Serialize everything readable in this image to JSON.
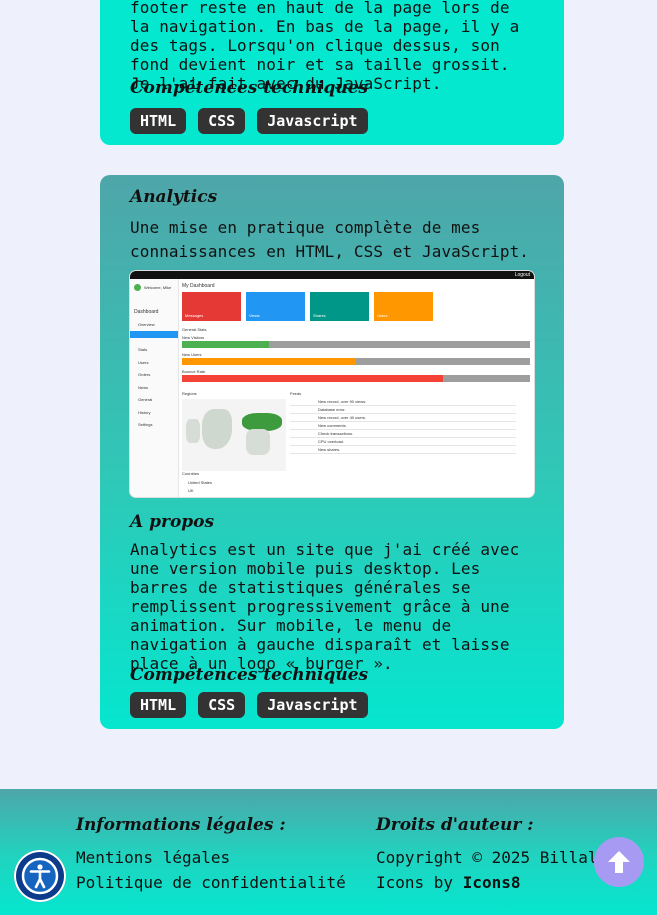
{
  "top_project": {
    "paragraph": "footer reste en haut de la page lors de la navigation. En bas de la page, il y a des tags. Lorsqu'on clique dessus, son fond devient noir et sa taille grossit. Je l'ai fait avec du JavaScript.",
    "skills_heading": "Compétences techniques",
    "tags": [
      "HTML",
      "CSS",
      "Javascript"
    ]
  },
  "analytics": {
    "title": "Analytics",
    "intro": "Une mise en pratique complète de mes connaissances en HTML, CSS et JavaScript.",
    "screenshot": {
      "logout": "Logout",
      "welcome": "Welcome, Mike",
      "page_title": "My Dashboard",
      "nav": [
        "Dashboard",
        "Overview",
        "Stats",
        "Users",
        "Orders",
        "News",
        "General",
        "History",
        "Settings"
      ],
      "tiles": [
        {
          "label": "Messages",
          "color": "#e53935"
        },
        {
          "label": "Views",
          "color": "#2196f3"
        },
        {
          "label": "Shares",
          "color": "#009688"
        },
        {
          "label": "Users",
          "color": "#ff9800"
        }
      ],
      "general_stats": "General Stats",
      "bars": [
        {
          "label": "New Visitors",
          "fill": 0.25,
          "color": "#4caf50"
        },
        {
          "label": "New Users",
          "fill": 0.5,
          "color": "#ff9800"
        },
        {
          "label": "Bounce Rate",
          "fill": 0.75,
          "color": "#f44336"
        }
      ],
      "regions": "Regions",
      "feeds": "Feeds",
      "feed_items": [
        "New record, over 90 views.",
        "Database error.",
        "New record, over 40 users.",
        "New comments.",
        "Check transactions.",
        "CPU overload.",
        "New shares."
      ],
      "countries": "Countries",
      "country_rows": [
        "United States",
        "UK"
      ]
    },
    "about_heading": "A propos",
    "about": "Analytics est un site que j'ai créé avec une version mobile puis desktop. Les barres de statistiques générales se remplissent progressivement grâce à une animation. Sur mobile, le menu de navigation à gauche disparaît et laisse place à un logo « burger ».",
    "skills_heading": "Compétences techniques",
    "tags": [
      "HTML",
      "CSS",
      "Javascript"
    ]
  },
  "footer": {
    "legal_title": "Informations légales :",
    "legal_links": [
      "Mentions légales",
      "Politique de confidentialité"
    ],
    "copyright_title": "Droits d'auteur :",
    "copyright_text": "Copyright © 2025 BillalDev",
    "icons_prefix": "Icons by ",
    "icons_link": "Icons8"
  },
  "icons": {
    "accessibility": "accessibility-icon",
    "scroll_top": "arrow-up-icon"
  },
  "colors": {
    "card_accent": "#04e8cf",
    "tag_bg": "#333333",
    "scroll_top_bg": "#a79af2",
    "a11y_bg": "#0d3b8c"
  }
}
